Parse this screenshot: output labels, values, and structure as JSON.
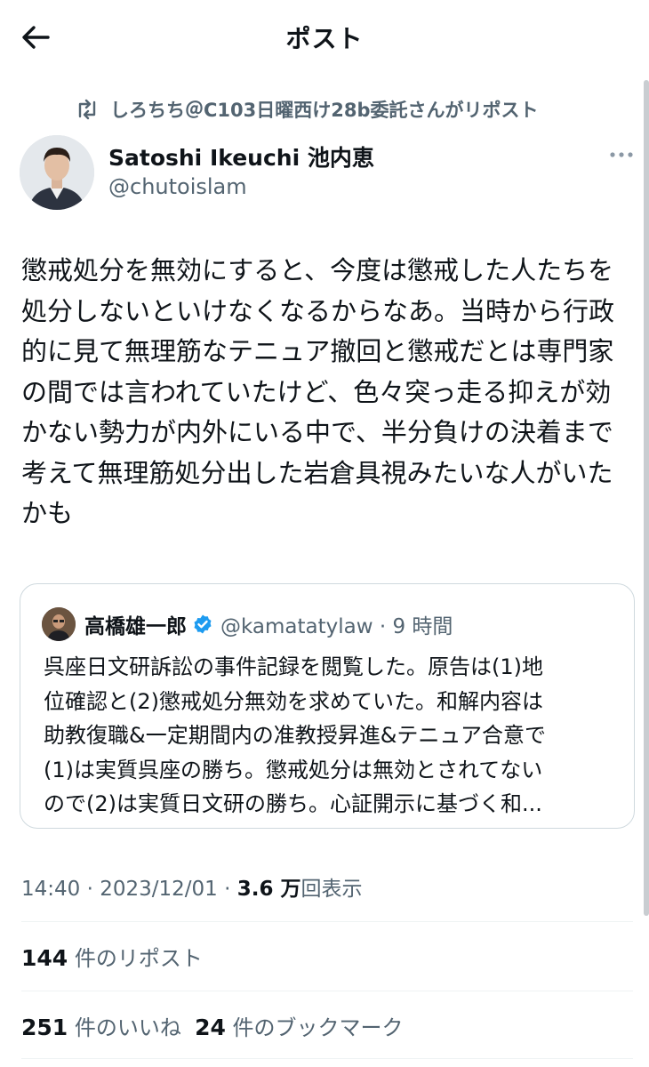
{
  "header": {
    "title": "ポスト"
  },
  "repost_banner": {
    "text": "しろちち＠C103日曜西け28b委託さんがリポスト"
  },
  "author": {
    "name": "Satoshi Ikeuchi 池内恵",
    "handle": "@chutoislam"
  },
  "post": {
    "lines": [
      "懲戒処分を無効にすると、今度は懲戒した人たちを",
      "処分しないといけなくなるからなあ。当時から行政",
      "的に見て無理筋なテニュア撤回と懲戒だとは専門家",
      "の間では言われていたけど、色々突っ走る抑えが効",
      "かない勢力が内外にいる中で、半分負けの決着まで",
      "考えて無理筋処分出した岩倉具視みたいな人がいた",
      "かも"
    ]
  },
  "quoted_post": {
    "name": "高橋雄一郎",
    "handle_time": "@kamatatylaw · 9 時間",
    "lines": [
      "呉座日文研訴訟の事件記録を閲覧した。原告は(1)地",
      "位確認と(2)懲戒処分無効を求めていた。和解内容は",
      "助教復職&一定期間内の准教授昇進&テニュア合意で",
      "(1)は実質呉座の勝ち。懲戒処分は無効とされてない",
      "ので(2)は実質日文研の勝ち。心証開示に基づく和..."
    ]
  },
  "meta": {
    "time_date": "14:40 · 2023/12/01 · ",
    "views_count": "3.6 万",
    "views_label": "回表示"
  },
  "stats": {
    "reposts_count": "144",
    "reposts_label": " 件のリポスト",
    "likes_count": "251",
    "likes_label": " 件のいいね",
    "bookmarks_count": "24",
    "bookmarks_label": " 件のブックマーク"
  },
  "colors": {
    "text": "#0f1419",
    "secondary": "#536471",
    "verified": "#1d9bf0",
    "border": "#cfd9de"
  },
  "icons": {
    "back": "arrow-left-icon",
    "repost": "repost-icon",
    "more": "more-icon",
    "verified": "verified-badge-icon"
  }
}
